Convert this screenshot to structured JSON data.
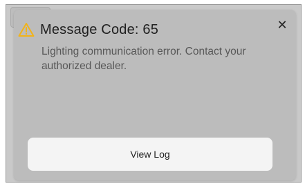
{
  "dialog": {
    "title": "Message Code: 65",
    "message": "Lighting communication error. Contact your authorized dealer.",
    "close_label": "✕",
    "view_log_label": "View Log",
    "warning_icon": "warning-triangle-icon",
    "colors": {
      "warning": "#f2b318",
      "dialog_bg": "#bcbcbc",
      "button_bg": "#f4f4f4"
    }
  }
}
